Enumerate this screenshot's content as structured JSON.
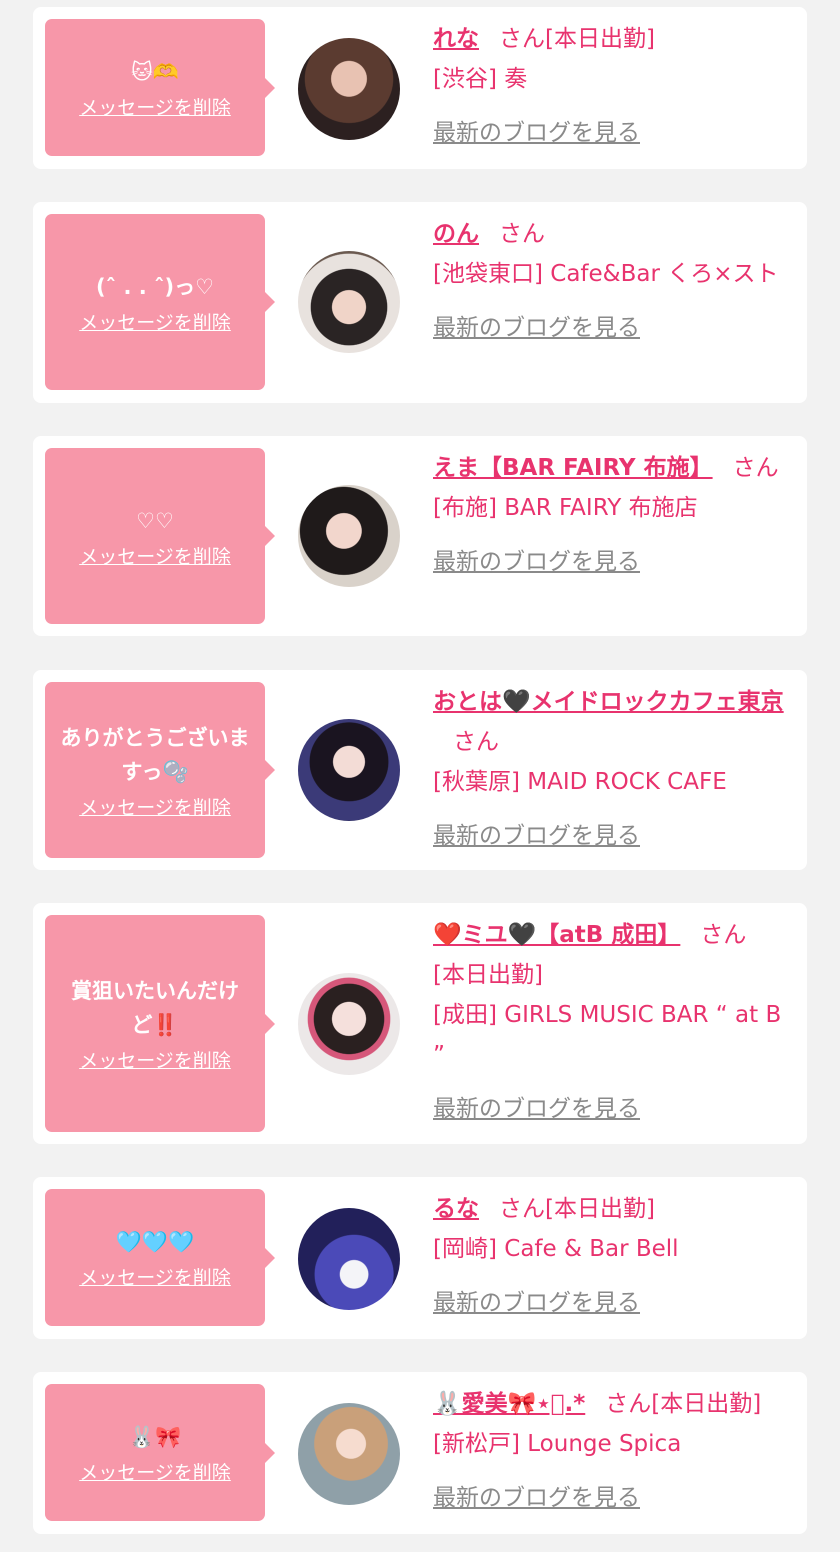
{
  "delete_label": "メッセージを削除",
  "blog_label": "最新のブログを見る",
  "san_label": "さん",
  "cards": [
    {
      "message": "🐱🫶",
      "name": "れな",
      "suffix": "[本日出勤]",
      "shop": "[渋谷] 奏"
    },
    {
      "message": "(ˆ . . ˆ)っ♡",
      "name": "のん",
      "suffix": "",
      "shop": "[池袋東口] Cafe&Bar くろ×スト"
    },
    {
      "message": "♡♡",
      "name": "えま【BAR FAIRY 布施】",
      "suffix": "",
      "shop": "[布施] BAR FAIRY 布施店"
    },
    {
      "message": "ありがとうございますっ🫧",
      "name": "おとは🖤メイドロックカフェ東京",
      "suffix": "",
      "shop": "[秋葉原] MAID ROCK CAFE"
    },
    {
      "message": "賞狙いたいんだけど‼️",
      "name": "❤️ミユ🖤【atB 成田】",
      "suffix": "[本日出勤]",
      "shop": "[成田] GIRLS MUSIC BAR “ at B ”"
    },
    {
      "message": "🩵🩵🩵",
      "name": "るな",
      "suffix": "[本日出勤]",
      "shop": "[岡崎] Cafe & Bar Bell"
    },
    {
      "message": "🐰🎀",
      "name": "🐰愛美🎀⋆͛.*",
      "suffix": "[本日出勤]",
      "shop": "[新松戸] Lounge Spica"
    }
  ]
}
